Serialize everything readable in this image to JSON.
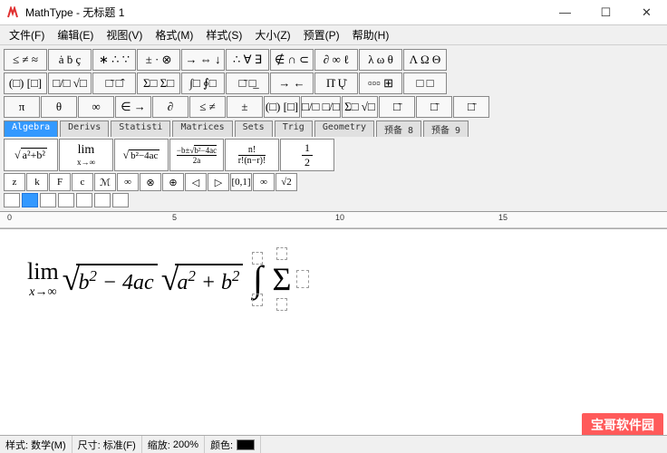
{
  "titlebar": {
    "app": "MathType",
    "doc": "无标题 1"
  },
  "menu": [
    "文件(F)",
    "编辑(E)",
    "视图(V)",
    "格式(M)",
    "样式(S)",
    "大小(Z)",
    "预置(P)",
    "帮助(H)"
  ],
  "palette": {
    "row1": [
      "≤ ≠ ≈",
      "ȧ ḃ ç",
      "∗ ∴ ∵",
      "± · ⊗",
      "→ ⇔ ↓",
      "∴ ∀ ∃",
      "∉ ∩ ⊂",
      "∂ ∞ ℓ",
      "λ ω θ",
      "Λ Ω Θ"
    ],
    "row2": [
      "(□) [□]",
      "□/□ √□",
      "□̄ □̂",
      "Σ□ Σ□",
      "∫□ ∮□",
      "□̄ □̲",
      "→ ←",
      "Π̇ Ų̇",
      "▫▫▫ ⊞",
      "□ □"
    ],
    "row3": [
      "π",
      "θ",
      "∞",
      "∈  →",
      "∂",
      "≤  ≠",
      "±",
      "(□) [□]",
      "□/□  □/□",
      "Σ□  √□",
      "□̄",
      "□̄",
      "□̄"
    ]
  },
  "tabs": [
    "Algebra",
    "Derivs",
    "Statisti",
    "Matrices",
    "Sets",
    "Trig",
    "Geometry",
    "预备 8",
    "预备 9"
  ],
  "templates": {
    "row1": [
      "√(a²+b²)",
      "lim x→∞",
      "√(b²−4ac)",
      "(−b±√(b²−4ac))/2a",
      "n!/(r!(n−r)!)",
      "1/2"
    ],
    "row2": [
      "z",
      "k",
      "F",
      "c",
      "ℳ",
      "∞",
      "⊗",
      "⊕",
      "◁",
      "▷",
      "[0,1]",
      "∞",
      "√2"
    ]
  },
  "ruler": {
    "marks": [
      "0",
      "5",
      "10",
      "15"
    ]
  },
  "editor": {
    "lim": {
      "op": "lim",
      "sub": "x→∞"
    },
    "sqrt1": "b² − 4ac",
    "sqrt2": "a² + b²"
  },
  "status": {
    "style_lbl": "样式:",
    "style_val": "数学(M)",
    "size_lbl": "尺寸:",
    "size_val": "标准(F)",
    "zoom_lbl": "缩放:",
    "zoom_val": "200%",
    "color_lbl": "颜色:"
  },
  "watermark": "宝哥软件园"
}
